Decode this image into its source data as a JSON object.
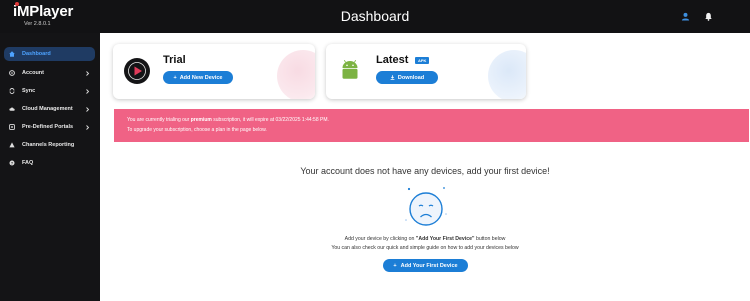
{
  "app": {
    "logo_im": "iM",
    "logo_player": "Player",
    "version": "Ver 2.8.0.1",
    "page_title": "Dashboard",
    "icons": {
      "user": "user-icon",
      "bell": "bell-icon"
    }
  },
  "colors": {
    "topbar": "#121214",
    "sidebar": "#141416",
    "accent": "#1c7ed6",
    "alert": "#f06285",
    "active_nav": "#1f3b63"
  },
  "sidebar": {
    "items": [
      {
        "label": "Dashboard",
        "icon": "home-icon",
        "active": true,
        "chevron": false
      },
      {
        "label": "Account",
        "icon": "gear-icon",
        "active": false,
        "chevron": true
      },
      {
        "label": "Sync",
        "icon": "sync-icon",
        "active": false,
        "chevron": true
      },
      {
        "label": "Cloud Management",
        "icon": "cloud-icon",
        "active": false,
        "chevron": true
      },
      {
        "label": "Pre-Defined Portals",
        "icon": "portal-icon",
        "active": false,
        "chevron": true
      },
      {
        "label": "Channels Reporting",
        "icon": "report-icon",
        "active": false,
        "chevron": false
      },
      {
        "label": "FAQ",
        "icon": "faq-icon",
        "active": false,
        "chevron": false
      }
    ]
  },
  "cards": {
    "trial": {
      "title": "Trial",
      "button": "Add New Device"
    },
    "latest": {
      "title": "Latest",
      "badge": "APK",
      "button": "Download"
    }
  },
  "alert": {
    "line1_prefix": "You are currently trialing our ",
    "line1_bold": "premium",
    "line1_suffix": " subscription, it will expire at 03/22/2025 1:44:58 PM.",
    "line2": "To upgrade your subscription, choose a plan in the page below."
  },
  "empty_state": {
    "title": "Your account does not have any devices, add your first device!",
    "hint1_prefix": "Add your device by clicking on ",
    "hint1_bold": "\"Add Your First Device\"",
    "hint1_suffix": " button below",
    "hint2": "You can also check our quick and simple guide on how to add your devices below",
    "button": "Add Your First Device"
  }
}
